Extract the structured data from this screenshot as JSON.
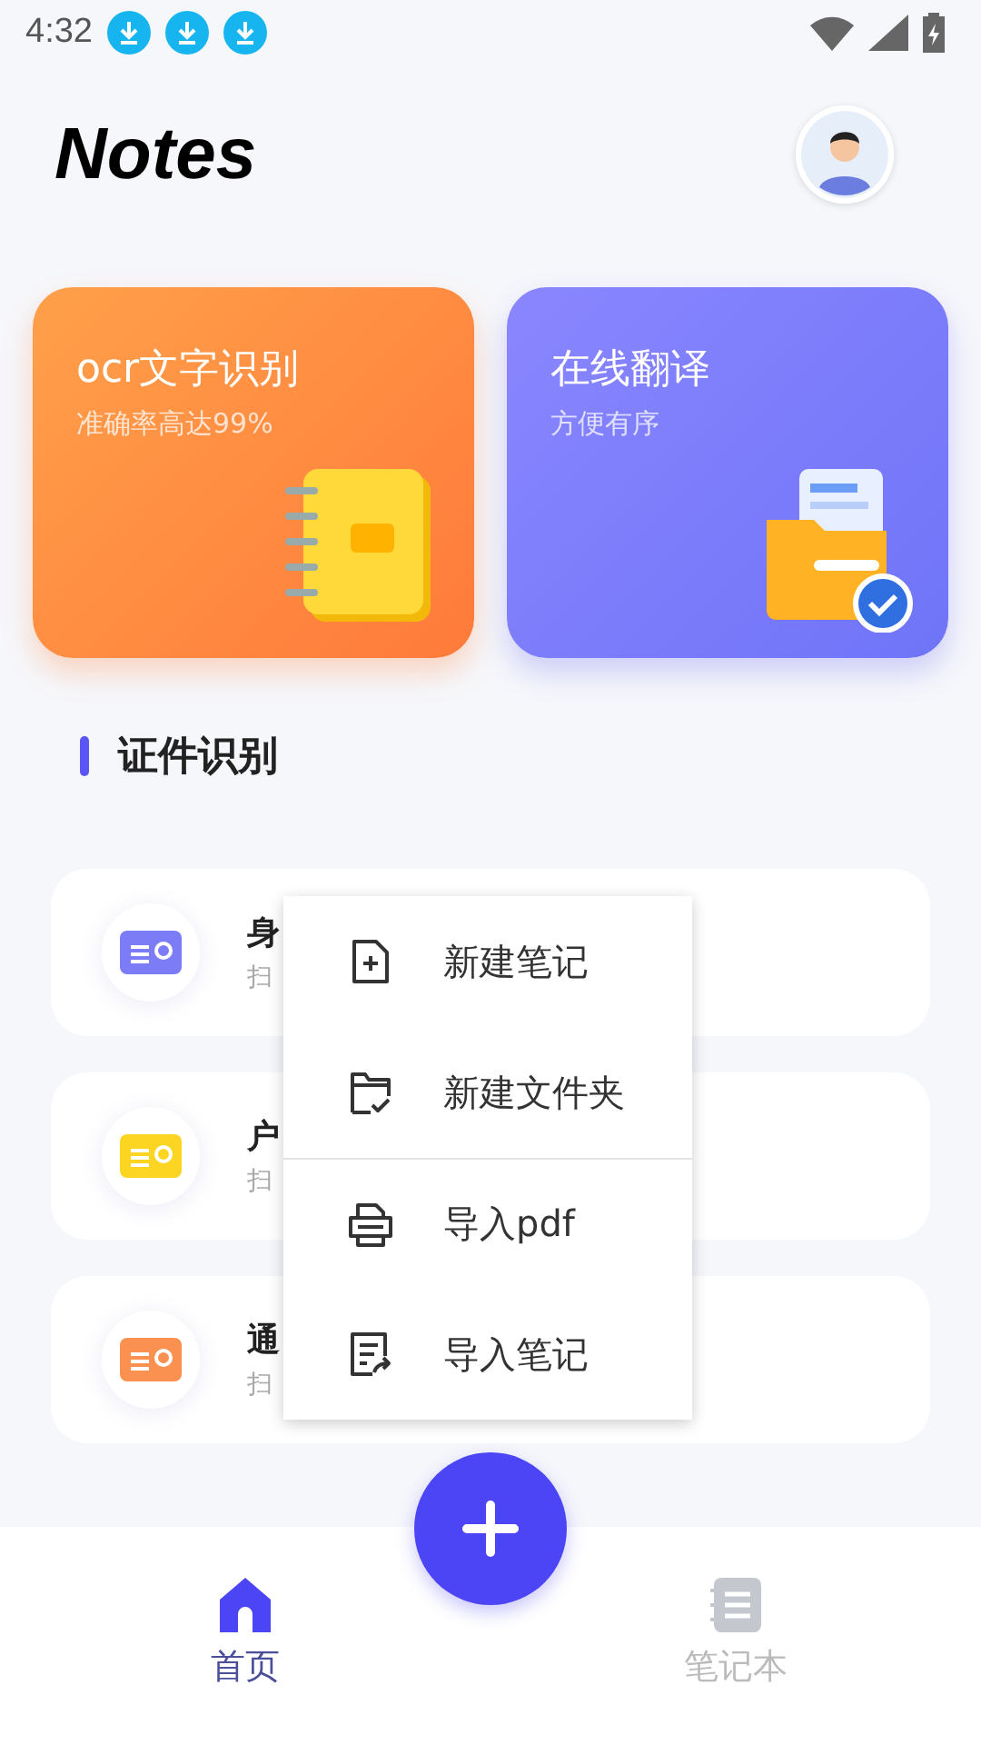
{
  "status_bar": {
    "time": "4:32",
    "notifications": [
      {
        "kind": "download"
      },
      {
        "kind": "download"
      },
      {
        "kind": "download"
      }
    ]
  },
  "header": {
    "title": "Notes"
  },
  "feature_cards": [
    {
      "kind": "ocr",
      "title": "ocr文字识别",
      "subtitle": "准确率高达99%"
    },
    {
      "kind": "translate",
      "title": "在线翻译",
      "subtitle": "方便有序"
    }
  ],
  "section": {
    "title": "证件识别"
  },
  "id_rows": [
    {
      "title": "身",
      "subtitle": "扫",
      "color": "#7b7cf6"
    },
    {
      "title": "户",
      "subtitle": "扫",
      "color": "#fcd523"
    },
    {
      "title": "通",
      "subtitle": "扫",
      "color": "#fb9150"
    }
  ],
  "popup_menu": {
    "groups": [
      {
        "items": [
          {
            "kind": "new-note",
            "label": "新建笔记"
          },
          {
            "kind": "new-folder",
            "label": "新建文件夹"
          }
        ]
      },
      {
        "items": [
          {
            "kind": "import-pdf",
            "label": "导入pdf"
          },
          {
            "kind": "import-note",
            "label": "导入笔记"
          }
        ]
      }
    ]
  },
  "bottom_nav": [
    {
      "kind": "home",
      "label": "首页",
      "selected": true
    },
    {
      "kind": "notebook",
      "label": "笔记本",
      "selected": false
    }
  ]
}
